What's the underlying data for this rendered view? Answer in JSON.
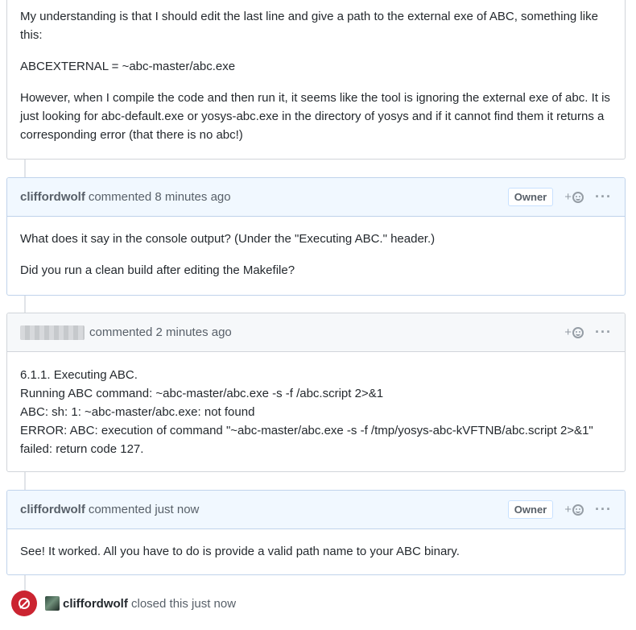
{
  "first_comment": {
    "paragraphs": [
      "My understanding is that I should edit the last line and give a path to the external exe of ABC, something like this:",
      "ABCEXTERNAL = ~abc-master/abc.exe",
      "However, when I compile the code and then run it, it seems like the tool is ignoring the external exe of abc. It is just looking for abc-default.exe or yosys-abc.exe in the directory of yosys and if it cannot find them it returns a corresponding error (that there is no abc!)"
    ]
  },
  "comment2": {
    "author": "cliffordwolf",
    "meta": "commented 8 minutes ago",
    "badge": "Owner",
    "paragraphs": [
      "What does it say in the console output? (Under the \"Executing ABC.\" header.)",
      "Did you run a clean build after editing the Makefile?"
    ]
  },
  "comment3": {
    "meta": "commented 2 minutes ago",
    "lines": [
      "6.1.1. Executing ABC.",
      "Running ABC command: ~abc-master/abc.exe -s -f /abc.script 2>&1",
      "ABC: sh: 1: ~abc-master/abc.exe: not found",
      "ERROR: ABC: execution of command \"~abc-master/abc.exe -s -f /tmp/yosys-abc-kVFTNB/abc.script 2>&1\"",
      "failed: return code 127."
    ]
  },
  "comment4": {
    "author": "cliffordwolf",
    "meta": "commented just now",
    "badge": "Owner",
    "paragraphs": [
      "See! It worked. All you have to do is provide a valid path name to your ABC binary."
    ]
  },
  "reaction_label": "+",
  "more_label": "···",
  "closed_event": {
    "author": "cliffordwolf",
    "text": "closed this just now"
  },
  "colors": {
    "owner_header_bg": "#f1f8ff",
    "closed_badge": "#cb2431"
  }
}
